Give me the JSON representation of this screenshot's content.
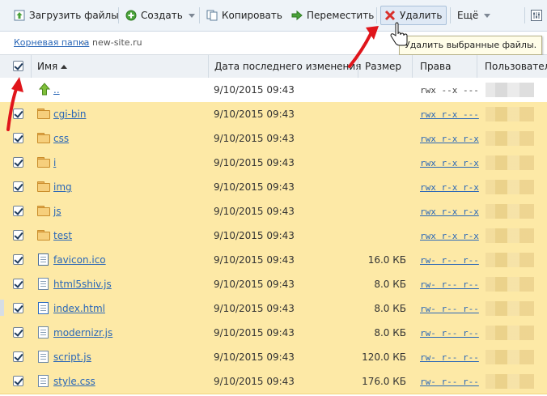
{
  "toolbar": {
    "upload_label": "Загрузить файлы",
    "create_label": "Создать",
    "copy_label": "Копировать",
    "move_label": "Переместить",
    "delete_label": "Удалить",
    "more_label": "Ещё"
  },
  "tooltip": {
    "text": "Удалить выбранные файлы."
  },
  "breadcrumb": {
    "root": "Корневая папка",
    "separator": "›",
    "current": "new-site.ru"
  },
  "columns": {
    "name": "Имя",
    "modified": "Дата последнего изменения",
    "size": "Размер",
    "perms": "Права",
    "user": "Пользовател"
  },
  "rows": [
    {
      "name": "..",
      "date": "9/10/2015 09:43",
      "size": "",
      "perms": "rwx --x ---"
    },
    {
      "name": "cgi-bin",
      "date": "9/10/2015 09:43",
      "size": "",
      "perms": "rwx r-x ---"
    },
    {
      "name": "css",
      "date": "9/10/2015 09:43",
      "size": "",
      "perms": "rwx r-x r-x"
    },
    {
      "name": "i",
      "date": "9/10/2015 09:43",
      "size": "",
      "perms": "rwx r-x r-x"
    },
    {
      "name": "img",
      "date": "9/10/2015 09:43",
      "size": "",
      "perms": "rwx r-x r-x"
    },
    {
      "name": "js",
      "date": "9/10/2015 09:43",
      "size": "",
      "perms": "rwx r-x r-x"
    },
    {
      "name": "test",
      "date": "9/10/2015 09:43",
      "size": "",
      "perms": "rwx r-x r-x"
    },
    {
      "name": "favicon.ico",
      "date": "9/10/2015 09:43",
      "size": "16.0 КБ",
      "perms": "rw- r-- r--"
    },
    {
      "name": "html5shiv.js",
      "date": "9/10/2015 09:43",
      "size": "8.0 КБ",
      "perms": "rw- r-- r--"
    },
    {
      "name": "index.html",
      "date": "9/10/2015 09:43",
      "size": "8.0 КБ",
      "perms": "rw- r-- r--"
    },
    {
      "name": "modernizr.js",
      "date": "9/10/2015 09:43",
      "size": "8.0 КБ",
      "perms": "rw- r-- r--"
    },
    {
      "name": "script.js",
      "date": "9/10/2015 09:43",
      "size": "120.0 КБ",
      "perms": "rw- r-- r--"
    },
    {
      "name": "style.css",
      "date": "9/10/2015 09:43",
      "size": "176.0 КБ",
      "perms": "rw- r-- r--"
    }
  ],
  "colors": {
    "accent": "#2a67b7",
    "selected_row": "#fde9a6",
    "annotation_arrow": "#e0151b"
  }
}
